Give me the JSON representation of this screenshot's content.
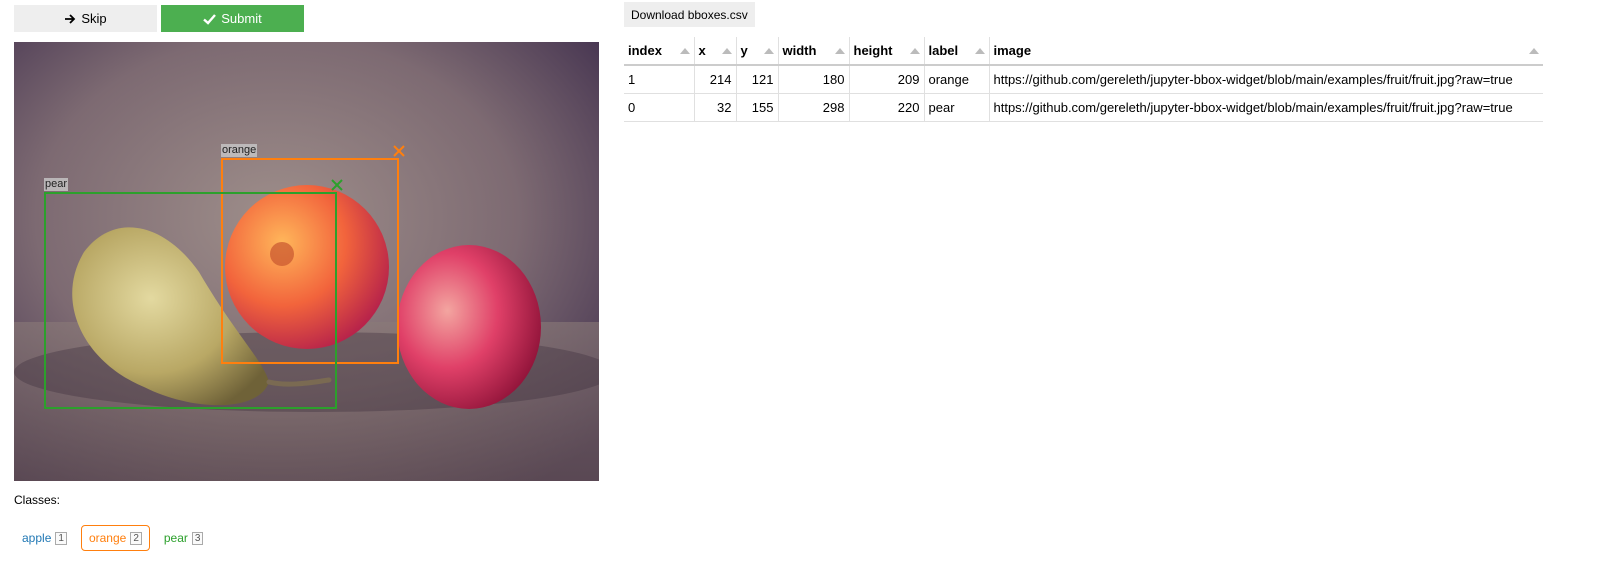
{
  "toolbar": {
    "skip_label": "Skip",
    "submit_label": "Submit",
    "skip_icon": "arrow-right-icon",
    "submit_icon": "check-icon"
  },
  "image_annotations": [
    {
      "label": "orange",
      "color": "#ff7f0e"
    },
    {
      "label": "pear",
      "color": "#2ca02c"
    }
  ],
  "classes": {
    "title": "Classes:",
    "items": [
      {
        "name": "apple",
        "key": "1",
        "color": "#1f77b4",
        "selected": false
      },
      {
        "name": "orange",
        "key": "2",
        "color": "#ff7f0e",
        "selected": true
      },
      {
        "name": "pear",
        "key": "3",
        "color": "#2ca02c",
        "selected": false
      }
    ]
  },
  "download": {
    "label": "Download bboxes.csv"
  },
  "table": {
    "columns": [
      "index",
      "x",
      "y",
      "width",
      "height",
      "label",
      "image"
    ],
    "rows": [
      [
        "1",
        "214",
        "121",
        "180",
        "209",
        "orange",
        "https://github.com/gereleth/jupyter-bbox-widget/blob/main/examples/fruit/fruit.jpg?raw=true"
      ],
      [
        "0",
        "32",
        "155",
        "298",
        "220",
        "pear",
        "https://github.com/gereleth/jupyter-bbox-widget/blob/main/examples/fruit/fruit.jpg?raw=true"
      ]
    ]
  }
}
